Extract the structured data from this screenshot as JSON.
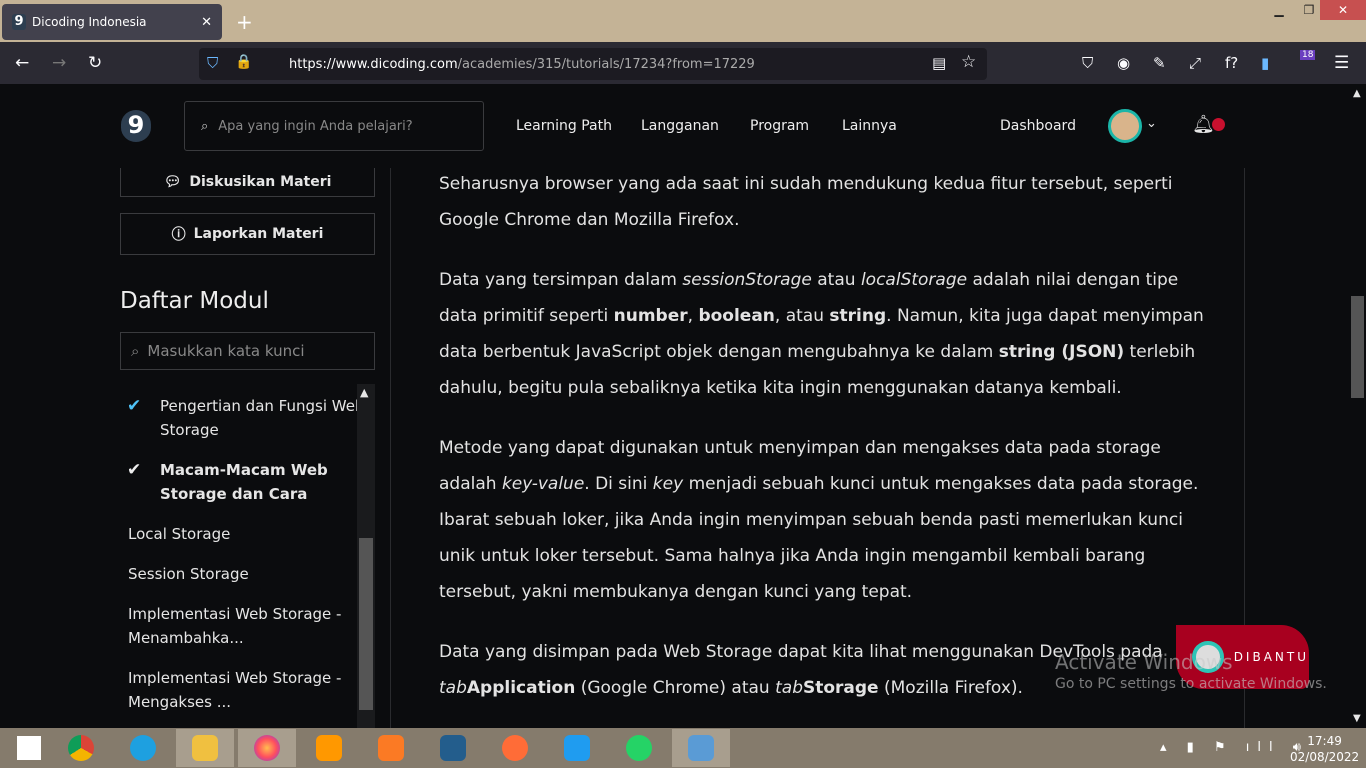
{
  "browser": {
    "tab_title": "Dicoding Indonesia",
    "url_host": "https://www.dicoding.com",
    "url_path": "/academies/315/tutorials/17234?from=17229",
    "extension_badge": "18"
  },
  "nav": {
    "logo": "9",
    "search_placeholder": "Apa yang ingin Anda pelajari?",
    "links": [
      "Learning Path",
      "Langganan",
      "Program",
      "Lainnya"
    ],
    "dashboard": "Dashboard"
  },
  "sidebar": {
    "discuss": "Diskusikan Materi",
    "report": "Laporkan Materi",
    "title": "Daftar Modul",
    "search_placeholder": "Masukkan kata kunci",
    "modules": [
      {
        "label": "Pengertian dan Fungsi Web Storage",
        "done": true
      },
      {
        "label": "Macam-Macam Web Storage dan Cara",
        "done": true,
        "current": true
      },
      {
        "label": "Local Storage"
      },
      {
        "label": "Session Storage"
      },
      {
        "label": "Implementasi Web Storage - Menambahka..."
      },
      {
        "label": "Implementasi Web Storage - Mengakses ..."
      }
    ]
  },
  "content": {
    "p1": "Seharusnya browser yang ada saat ini sudah mendukung kedua fitur tersebut, seperti Google Chrome dan Mozilla Firefox.",
    "p2": [
      "Data yang tersimpan dalam ",
      "sessionStorage",
      " atau ",
      "localStorage",
      " adalah nilai dengan tipe data primitif seperti ",
      "number",
      ", ",
      "boolean",
      ", atau ",
      "string",
      ". Namun, kita juga dapat menyimpan data berbentuk JavaScript objek dengan mengubahnya ke dalam ",
      "string (JSON)",
      " terlebih dahulu, begitu pula sebaliknya ketika kita ingin menggunakan datanya kembali."
    ],
    "p3": [
      "Metode yang dapat digunakan untuk menyimpan dan mengakses data pada storage adalah ",
      "key-value",
      ". Di sini ",
      "key",
      " menjadi sebuah kunci untuk mengakses data pada storage. Ibarat sebuah loker, jika Anda ingin menyimpan sebuah benda pasti memerlukan kunci unik untuk loker tersebut. Sama halnya jika Anda ingin mengambil kembali barang tersebut, yakni membukanya dengan kunci yang tepat."
    ],
    "p4": [
      "Data yang disimpan pada Web Storage dapat kita lihat menggunakan DevTools pada ",
      "tab",
      "Application",
      " (Google Chrome) atau ",
      "tab",
      "Storage",
      " (Mozilla Firefox)."
    ]
  },
  "dibantu": "DIBANTU",
  "watermark": {
    "line1": "Activate Windows",
    "line2": "Go to PC settings to activate Windows."
  },
  "taskbar": {
    "time": "17:49",
    "date": "02/08/2022"
  },
  "colors": {
    "accent": "#4fc3f7",
    "dibantu": "#a8001f",
    "notification": "#c8102e"
  }
}
